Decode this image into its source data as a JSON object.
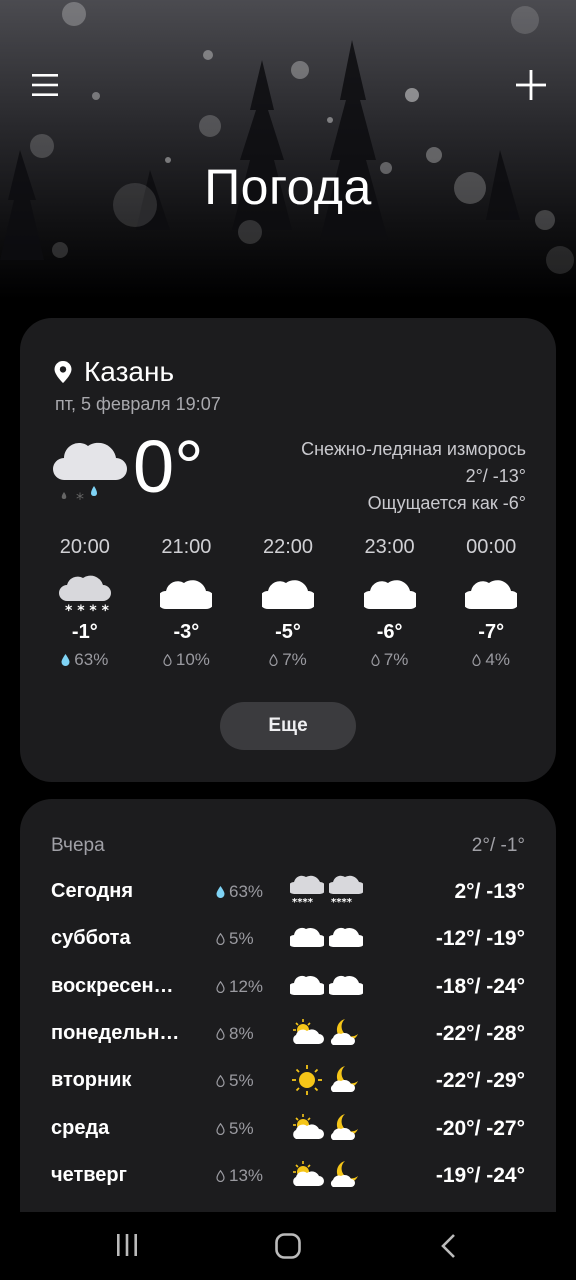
{
  "header": {
    "title": "Погода",
    "menu_icon": "hamburger-menu-icon",
    "add_icon": "plus-icon"
  },
  "current": {
    "city": "Казань",
    "datetime": "пт, 5 февраля 19:07",
    "temperature": "0°",
    "condition": "Снежно-ледяная изморось",
    "high_low": "2°/ -13°",
    "feels_like": "Ощущается как -6°",
    "icon": "cloud-sleet-icon"
  },
  "hourly": [
    {
      "time": "20:00",
      "temp": "-1°",
      "precip": "63%",
      "icon": "cloud-snow-icon"
    },
    {
      "time": "21:00",
      "temp": "-3°",
      "precip": "10%",
      "icon": "cloud-icon"
    },
    {
      "time": "22:00",
      "temp": "-5°",
      "precip": "7%",
      "icon": "cloud-icon"
    },
    {
      "time": "23:00",
      "temp": "-6°",
      "precip": "7%",
      "icon": "cloud-icon"
    },
    {
      "time": "00:00",
      "temp": "-7°",
      "precip": "4%",
      "icon": "cloud-icon"
    }
  ],
  "more_button": "Еще",
  "yesterday": {
    "label": "Вчера",
    "temps": "2°/ -1°"
  },
  "daily": [
    {
      "day": "Сегодня",
      "precip": "63%",
      "icons": [
        "cloud-snow-icon",
        "cloud-snow-icon"
      ],
      "temps": "2°/ -13°"
    },
    {
      "day": "суббота",
      "precip": "5%",
      "icons": [
        "cloud-icon",
        "cloud-icon"
      ],
      "temps": "-12°/ -19°"
    },
    {
      "day": "воскресен…",
      "precip": "12%",
      "icons": [
        "cloud-icon",
        "cloud-icon"
      ],
      "temps": "-18°/ -24°"
    },
    {
      "day": "понедельн…",
      "precip": "8%",
      "icons": [
        "sun-cloud-icon",
        "moon-cloud-icon"
      ],
      "temps": "-22°/ -28°"
    },
    {
      "day": "вторник",
      "precip": "5%",
      "icons": [
        "sun-icon",
        "moon-cloud-icon"
      ],
      "temps": "-22°/ -29°"
    },
    {
      "day": "среда",
      "precip": "5%",
      "icons": [
        "sun-cloud-icon",
        "moon-cloud-icon"
      ],
      "temps": "-20°/ -27°"
    },
    {
      "day": "четверг",
      "precip": "13%",
      "icons": [
        "sun-cloud-icon",
        "moon-cloud-icon"
      ],
      "temps": "-19°/ -24°"
    }
  ],
  "colors": {
    "background": "#000000",
    "card": "#1c1c1e",
    "button": "#3b3b3e",
    "drop_active": "#7fd3f5",
    "sun": "#f5c518"
  },
  "navbar": {
    "recents_icon": "recents-icon",
    "home_icon": "home-icon",
    "back_icon": "back-icon"
  }
}
